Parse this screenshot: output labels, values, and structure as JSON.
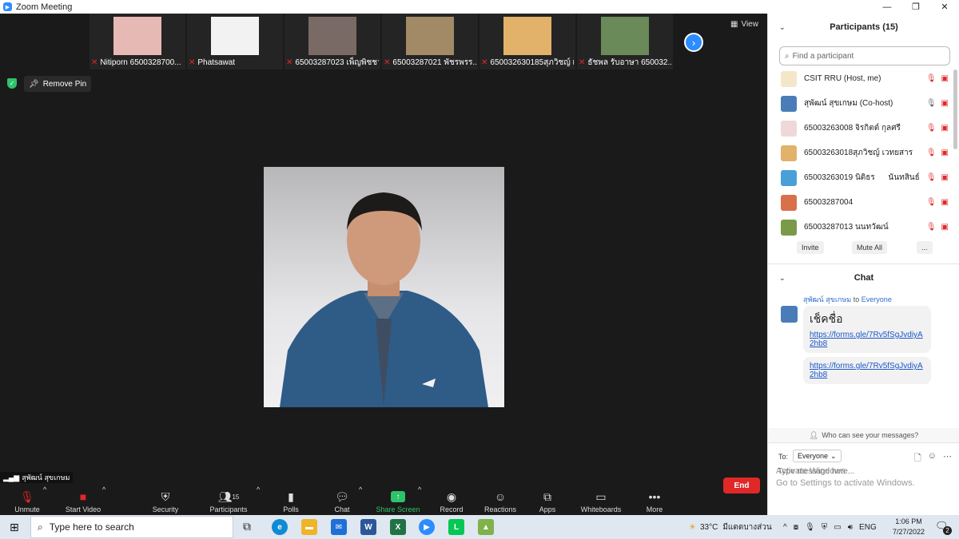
{
  "window": {
    "title": "Zoom Meeting",
    "minimize": "—",
    "restore": "❐",
    "close": "✕"
  },
  "strip": {
    "tiles": [
      {
        "name": "Nitiporn 6500328700...",
        "color": "#e6b9b4"
      },
      {
        "name": "Phatsawat",
        "color": "#f2f2f2"
      },
      {
        "name": "65003287023 เพ็ญพิชชา",
        "color": "#7a6a66"
      },
      {
        "name": "65003287021 พัชรพรร...",
        "color": "#a38a66"
      },
      {
        "name": "650032630185สุภวิชญ์ เ...",
        "color": "#e2b26a"
      },
      {
        "name": "ธัชพล รับอาษา 650032...",
        "color": "#6a8a5a"
      }
    ],
    "next_icon": "›",
    "view_label": "View"
  },
  "pin": {
    "label": "Remove Pin"
  },
  "speaker": {
    "name": "สุพัฒน์ สุขเกษม"
  },
  "toolbar": {
    "unmute": "Unmute",
    "start_video": "Start Video",
    "security": "Security",
    "participants": "Participants",
    "participants_count": "15",
    "polls": "Polls",
    "chat": "Chat",
    "share_screen": "Share Screen",
    "record": "Record",
    "reactions": "Reactions",
    "apps": "Apps",
    "whiteboards": "Whiteboards",
    "more": "More",
    "end": "End"
  },
  "participants": {
    "title": "Participants (15)",
    "search_placeholder": "Find a participant",
    "list": [
      {
        "name": "CSIT RRU (Host, me)",
        "color": "#f4e7c9"
      },
      {
        "name": "สุพัฒน์ สุขเกษม (Co-host)",
        "color": "#4a7db8"
      },
      {
        "name": "65003263008 จิรกิตต์ กุลศรี",
        "color": "#f0d8d8"
      },
      {
        "name": "65003263018สุภวิชญ์ เวทยสาร",
        "color": "#e2b26a"
      },
      {
        "name": "65003263019 นิติธร      นันทสินธ์",
        "color": "#4aa0d6"
      },
      {
        "name": "65003287004",
        "color": "#d8704a"
      },
      {
        "name": "65003287013 นนทวัฒน์",
        "color": "#7a9a4a"
      }
    ],
    "invite": "Invite",
    "mute_all": "Mute All",
    "more": "..."
  },
  "chat": {
    "title": "Chat",
    "sender": "สุพัฒน์ สุขเกษม",
    "to_word": "to",
    "recipient": "Everyone",
    "msg1_text": "เช็คชื่อ",
    "msg1_link": "https://forms.gle/7Rv5fSgJvdiyA2hb8",
    "msg2_link": "https://forms.gle/7Rv5fSgJvdiyA2hb8",
    "who_can_see": "Who can see your messages?",
    "to_label": "To:",
    "to_value": "Everyone",
    "placeholder": "Type message here..."
  },
  "watermark": {
    "line1": "Activate Windows",
    "line2": "Go to Settings to activate Windows."
  },
  "taskbar": {
    "search_placeholder": "Type here to search",
    "weather": "33°C",
    "weather_desc": "มีแดดบางส่วน",
    "lang": "ENG",
    "time": "1:06 PM",
    "date": "7/27/2022",
    "notif_count": "2"
  }
}
